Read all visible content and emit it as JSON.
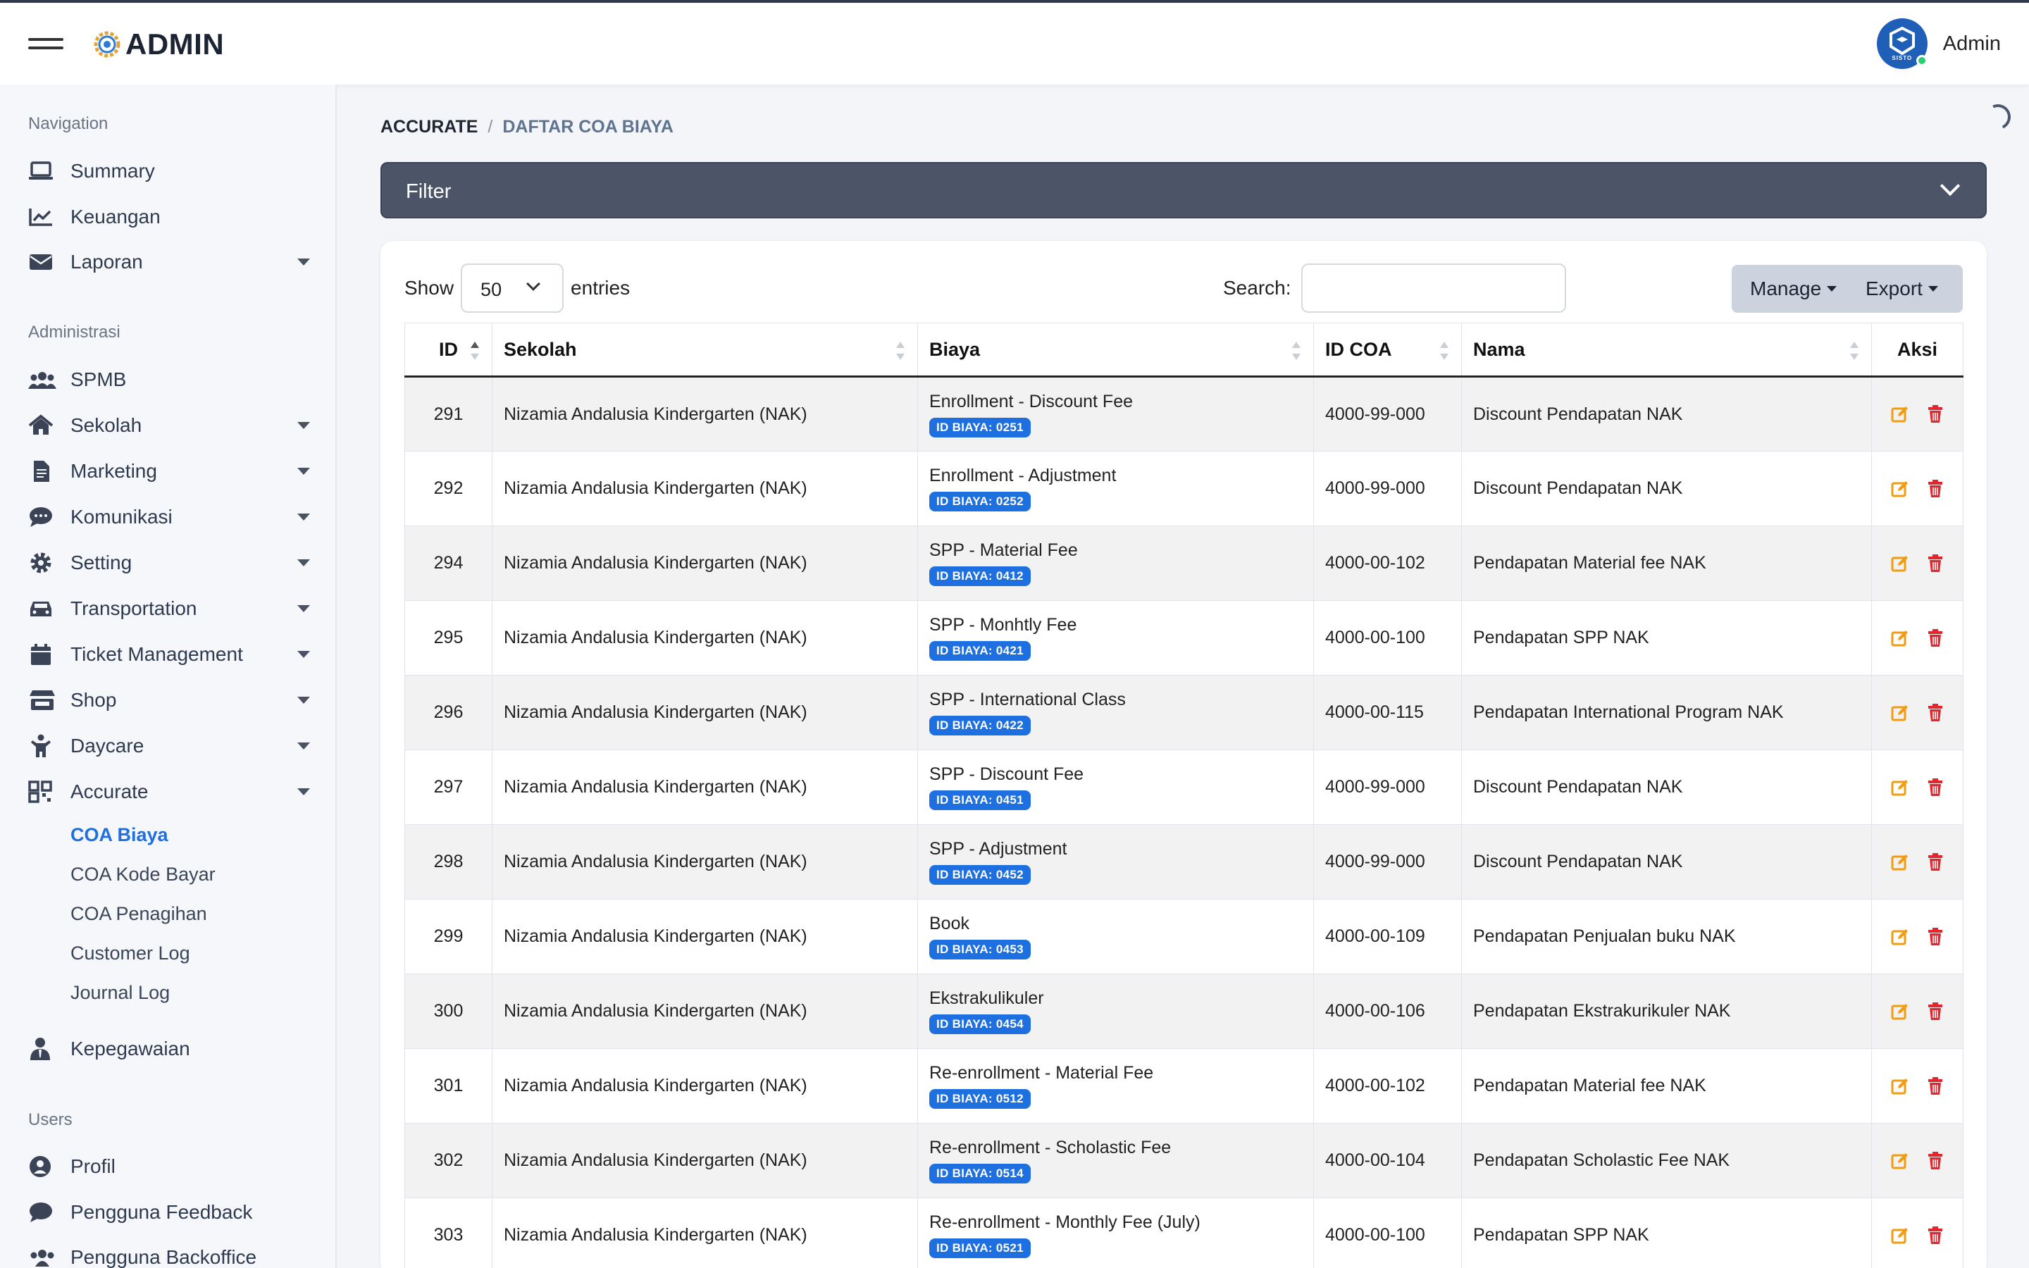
{
  "header": {
    "brand": "ADMIN",
    "user_name": "Admin",
    "avatar_text": "SISTO"
  },
  "sidebar": {
    "sections": {
      "navigation": "Navigation",
      "administrasi": "Administrasi",
      "users": "Users"
    },
    "items": {
      "summary": "Summary",
      "keuangan": "Keuangan",
      "laporan": "Laporan",
      "spmb": "SPMB",
      "sekolah": "Sekolah",
      "marketing": "Marketing",
      "komunikasi": "Komunikasi",
      "setting": "Setting",
      "transportation": "Transportation",
      "ticket": "Ticket Management",
      "shop": "Shop",
      "daycare": "Daycare",
      "accurate": "Accurate",
      "kepegawaian": "Kepegawaian",
      "profil": "Profil",
      "feedback": "Pengguna Feedback",
      "backoffice": "Pengguna Backoffice"
    },
    "accurate_sub": {
      "coa_biaya": "COA Biaya",
      "coa_kode_bayar": "COA Kode Bayar",
      "coa_penagihan": "COA Penagihan",
      "customer_log": "Customer Log",
      "journal_log": "Journal Log"
    }
  },
  "breadcrumb": {
    "parent": "ACCURATE",
    "separator": "/",
    "current": "DAFTAR COA BIAYA"
  },
  "filter": {
    "label": "Filter"
  },
  "controls": {
    "show_label": "Show",
    "entries_value": "50",
    "entries_label": "entries",
    "search_label": "Search:",
    "search_value": "",
    "manage_label": "Manage",
    "export_label": "Export"
  },
  "table": {
    "headers": {
      "id": "ID",
      "sekolah": "Sekolah",
      "biaya": "Biaya",
      "id_coa": "ID COA",
      "nama": "Nama",
      "aksi": "Aksi"
    },
    "rows": [
      {
        "id": "291",
        "sekolah": "Nizamia Andalusia Kindergarten (NAK)",
        "biaya": "Enrollment - Discount Fee",
        "badge": "ID BIAYA: 0251",
        "id_coa": "4000-99-000",
        "nama": "Discount Pendapatan NAK"
      },
      {
        "id": "292",
        "sekolah": "Nizamia Andalusia Kindergarten (NAK)",
        "biaya": "Enrollment - Adjustment",
        "badge": "ID BIAYA: 0252",
        "id_coa": "4000-99-000",
        "nama": "Discount Pendapatan NAK"
      },
      {
        "id": "294",
        "sekolah": "Nizamia Andalusia Kindergarten (NAK)",
        "biaya": "SPP - Material Fee",
        "badge": "ID BIAYA: 0412",
        "id_coa": "4000-00-102",
        "nama": "Pendapatan Material fee NAK"
      },
      {
        "id": "295",
        "sekolah": "Nizamia Andalusia Kindergarten (NAK)",
        "biaya": "SPP - Monhtly Fee",
        "badge": "ID BIAYA: 0421",
        "id_coa": "4000-00-100",
        "nama": "Pendapatan SPP NAK"
      },
      {
        "id": "296",
        "sekolah": "Nizamia Andalusia Kindergarten (NAK)",
        "biaya": "SPP - International Class",
        "badge": "ID BIAYA: 0422",
        "id_coa": "4000-00-115",
        "nama": "Pendapatan International Program NAK"
      },
      {
        "id": "297",
        "sekolah": "Nizamia Andalusia Kindergarten (NAK)",
        "biaya": "SPP - Discount Fee",
        "badge": "ID BIAYA: 0451",
        "id_coa": "4000-99-000",
        "nama": "Discount Pendapatan NAK"
      },
      {
        "id": "298",
        "sekolah": "Nizamia Andalusia Kindergarten (NAK)",
        "biaya": "SPP - Adjustment",
        "badge": "ID BIAYA: 0452",
        "id_coa": "4000-99-000",
        "nama": "Discount Pendapatan NAK"
      },
      {
        "id": "299",
        "sekolah": "Nizamia Andalusia Kindergarten (NAK)",
        "biaya": "Book",
        "badge": "ID BIAYA: 0453",
        "id_coa": "4000-00-109",
        "nama": "Pendapatan Penjualan buku NAK"
      },
      {
        "id": "300",
        "sekolah": "Nizamia Andalusia Kindergarten (NAK)",
        "biaya": "Ekstrakulikuler",
        "badge": "ID BIAYA: 0454",
        "id_coa": "4000-00-106",
        "nama": "Pendapatan Ekstrakurikuler NAK"
      },
      {
        "id": "301",
        "sekolah": "Nizamia Andalusia Kindergarten (NAK)",
        "biaya": "Re-enrollment - Material Fee",
        "badge": "ID BIAYA: 0512",
        "id_coa": "4000-00-102",
        "nama": "Pendapatan Material fee NAK"
      },
      {
        "id": "302",
        "sekolah": "Nizamia Andalusia Kindergarten (NAK)",
        "biaya": "Re-enrollment - Scholastic Fee",
        "badge": "ID BIAYA: 0514",
        "id_coa": "4000-00-104",
        "nama": "Pendapatan Scholastic Fee NAK"
      },
      {
        "id": "303",
        "sekolah": "Nizamia Andalusia Kindergarten (NAK)",
        "biaya": "Re-enrollment - Monthly Fee (July)",
        "badge": "ID BIAYA: 0521",
        "id_coa": "4000-00-100",
        "nama": "Pendapatan SPP NAK"
      }
    ]
  },
  "colors": {
    "accent": "#1e6fe0",
    "sidebar_bg": "#f6f7fb",
    "filter_bg": "#4b5567",
    "edit": "#f39c12",
    "delete": "#e3262e"
  },
  "icons": [
    "hamburger-icon",
    "gear-logo-icon",
    "laptop-icon",
    "chart-line-icon",
    "envelope-icon",
    "users-icon",
    "home-icon",
    "file-icon",
    "comment-icon",
    "cog-icon",
    "car-icon",
    "calendar-icon",
    "store-icon",
    "child-icon",
    "qrcode-icon",
    "user-tie-icon",
    "user-circle-icon",
    "edit-icon",
    "trash-icon"
  ]
}
